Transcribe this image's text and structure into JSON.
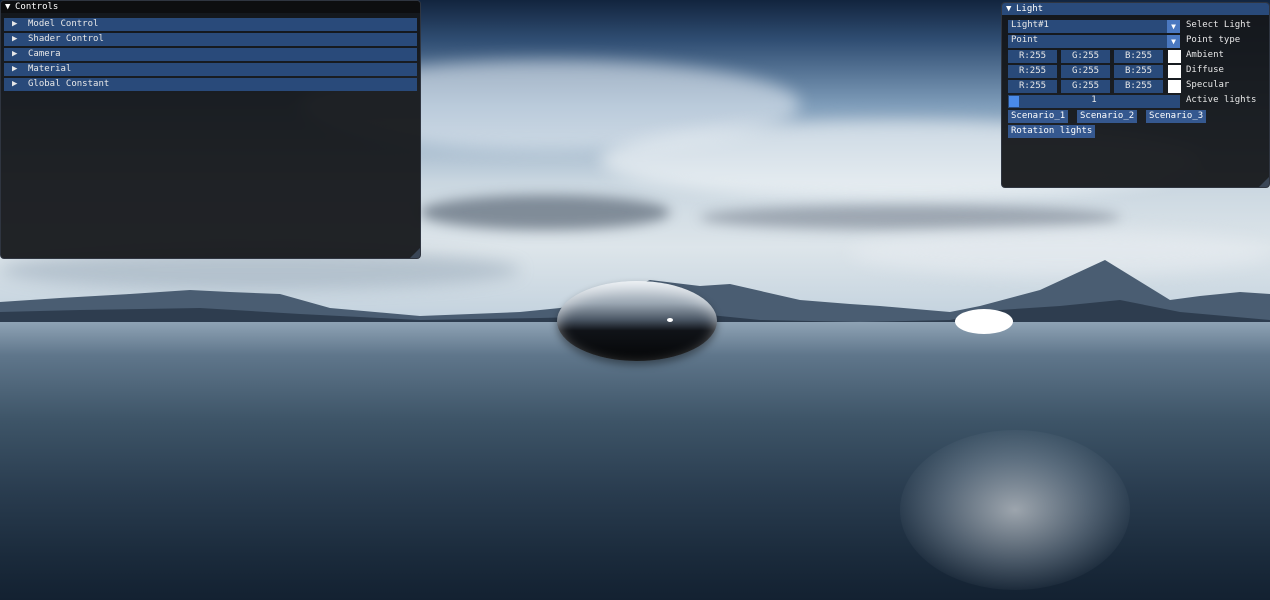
{
  "controls_window": {
    "title": "Controls",
    "headers": [
      "Model Control",
      "Shader Control",
      "Camera",
      "Material",
      "Global Constant"
    ]
  },
  "light_window": {
    "title": "Light",
    "select_light": {
      "value": "Light#1",
      "label": "Select Light"
    },
    "point_type": {
      "value": "Point",
      "label": "Point type"
    },
    "colors": [
      {
        "label": "Ambient",
        "r": "R:255",
        "g": "G:255",
        "b": "B:255",
        "swatch": "#ffffff"
      },
      {
        "label": "Diffuse",
        "r": "R:255",
        "g": "G:255",
        "b": "B:255",
        "swatch": "#ffffff"
      },
      {
        "label": "Specular",
        "r": "R:255",
        "g": "G:255",
        "b": "B:255",
        "swatch": "#ffffff"
      }
    ],
    "active_lights": {
      "value": "1",
      "label": "Active lights"
    },
    "scenario_buttons": [
      "Scenario_1",
      "Scenario_2",
      "Scenario_3"
    ],
    "rotation_button": "Rotation lights"
  },
  "icons": {
    "expanded": "▼",
    "collapsed": "▶",
    "dropdown": "▼"
  },
  "colors": {
    "accent": "#294a7a",
    "button": "#35588f",
    "slider_grab": "#4a8ae8",
    "window_bg": "#141619"
  }
}
